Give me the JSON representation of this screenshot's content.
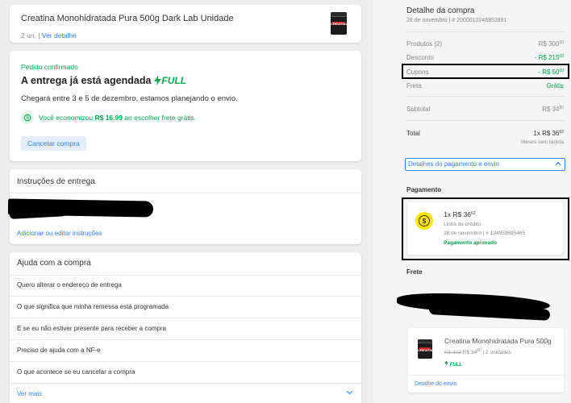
{
  "product": {
    "title": "Creatina Monohidratada Pura 500g Dark Lab Unidade",
    "quantity": "2 un.",
    "separator": "|",
    "detail_link": "Ver detalhe",
    "thumb_label": "CREATINA"
  },
  "status": {
    "confirmed": "Pedido confirmado",
    "title": "A entrega já está agendada",
    "full_label": "FULL",
    "description": "Chegará entre 3 e 5 de dezembro, estamos planejando o envio.",
    "savings_prefix": "Você economizou ",
    "savings_amount": "R$ 16.99",
    "savings_suffix": " ao escolher frete grátis.",
    "cancel_button": "Cancelar compra"
  },
  "instructions": {
    "title": "Instruções de entrega",
    "edit_link": "Adicionar ou editar instruções"
  },
  "help": {
    "title": "Ajuda com a compra",
    "items": [
      "Quero alterar o endereço de entrega",
      "O que significa que minha remessa está programada",
      "E se eu não estiver presente para receber a compra",
      "Preciso de ajuda com a NF-e",
      "O que acontece se eu cancelar a compra"
    ],
    "more": "Ver mais"
  },
  "summary": {
    "title": "Detalhe da compra",
    "date": "28 de novembro",
    "separator": "|",
    "order_number": "# 2000010246852891",
    "rows": {
      "produtos": {
        "label": "Produtos (2)",
        "value": "R$ 300",
        "cents": "00"
      },
      "desconto": {
        "label": "Desconto",
        "value": "- R$ 215",
        "cents": "00"
      },
      "cupons": {
        "label": "Cupons",
        "value": "- R$ 50",
        "cents": "00"
      },
      "frete": {
        "label": "Frete",
        "value": "Grátis"
      },
      "subtotal": {
        "label": "Subtotal",
        "value": "R$ 34",
        "cents": "80"
      }
    },
    "total": {
      "label": "Total",
      "value": "1x R$ 36",
      "cents": "62",
      "note": "Meses sem tarjeta"
    },
    "details_link": "Detalhes do pagamento e envio"
  },
  "payment": {
    "title": "Pagamento",
    "amount": "1x R$ 36",
    "cents": "62",
    "method": "Linha de crédito",
    "date": "28 de novembro",
    "separator": "|",
    "ref": "# 134959695465",
    "status": "Pagamento aprovado"
  },
  "shipping": {
    "title": "Frete",
    "item_name": "Creatina Monohidratada Pura 500g",
    "old_price": "R$ 300",
    "price": "R$ 34",
    "price_cents": "80",
    "units": "2 unidades",
    "separator": "|",
    "full_label": "FULL",
    "detail_link": "Detalhe do envio"
  },
  "colors": {
    "accent_blue": "#3483fa",
    "success_green": "#00a650",
    "coin_yellow": "#ffe600",
    "background": "#ededed"
  }
}
